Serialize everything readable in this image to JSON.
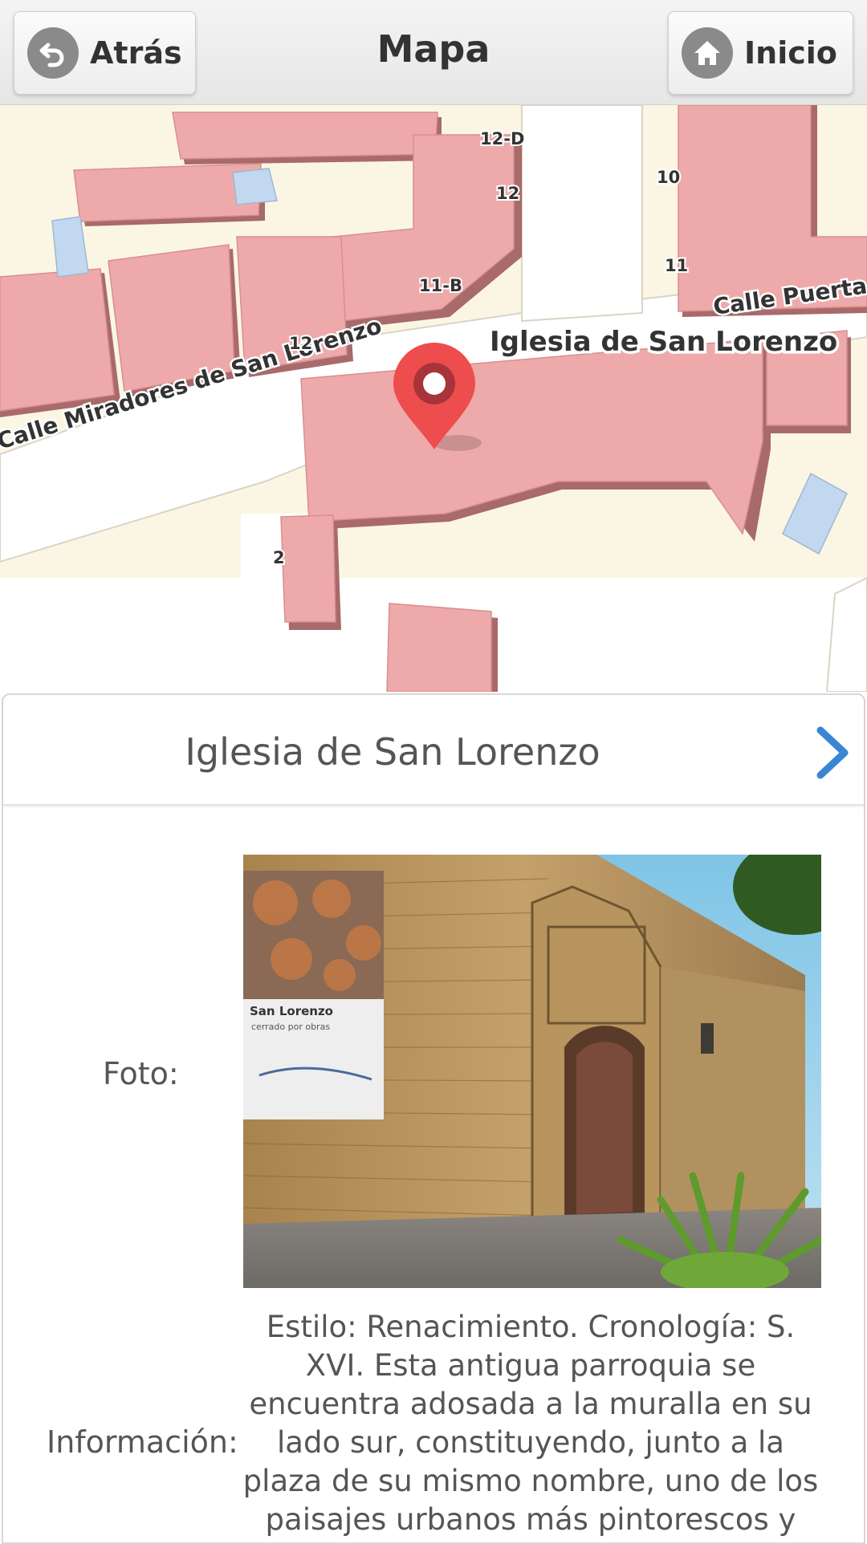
{
  "header": {
    "back_label": "Atrás",
    "title": "Mapa",
    "home_label": "Inicio"
  },
  "map": {
    "street_labels": [
      "Calle Miradores de San Lorenzo",
      "Calle Puerta d"
    ],
    "poi_label": "Iglesia de San Lorenzo",
    "house_numbers": [
      "12-D",
      "12",
      "10",
      "11",
      "11-B",
      "12",
      "2"
    ]
  },
  "card": {
    "title": "Iglesia de San Lorenzo",
    "photo_label": "Foto:",
    "info_label": "Información:",
    "info_text": "Estilo: Renacimiento. Cronología: S. XVI. Esta antigua parroquia se encuentra adosada a la muralla en su lado sur, constituyendo, junto a la plaza de su mismo nombre, uno de los paisajes urbanos más pintorescos y",
    "banner_text": [
      "San Lorenzo",
      "cerrado por obras"
    ]
  },
  "colors": {
    "building": "#eeaaaa",
    "building_shadow": "#a86a6a",
    "land": "#fbf6e3",
    "marker": "#ee4d4d",
    "chevron": "#3a86d4"
  },
  "icons": {
    "back": "back-arrow-icon",
    "home": "home-icon",
    "marker": "map-pin-icon",
    "next": "chevron-right-icon"
  }
}
